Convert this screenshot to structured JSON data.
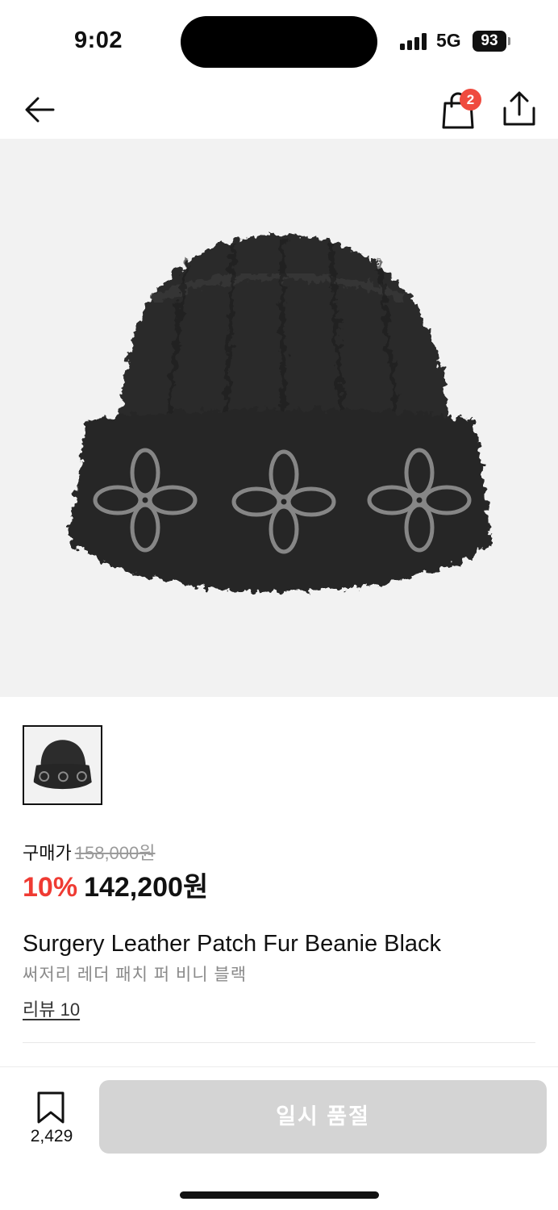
{
  "status_bar": {
    "time": "9:02",
    "network": "5G",
    "battery": "93"
  },
  "header": {
    "cart_count": "2",
    "icons": [
      "arrow-left-icon",
      "shopping-bag-icon",
      "share-icon"
    ]
  },
  "product": {
    "price_label": "구매가",
    "original_price": "158,000원",
    "discount": "10%",
    "sale_price": "142,200원",
    "name_en": "Surgery Leather Patch Fur Beanie Black",
    "name_ko": "써저리 레더 패치 퍼 비니 블랙",
    "review_link": "리뷰 10"
  },
  "bottom_bar": {
    "bookmark_count": "2,429",
    "soldout_label": "일시 품절"
  },
  "colors": {
    "discount": "#ef3b33",
    "badge": "#ef4b3f",
    "soldout_button": "#d4d4d4",
    "image_bg": "#f2f2f2"
  }
}
